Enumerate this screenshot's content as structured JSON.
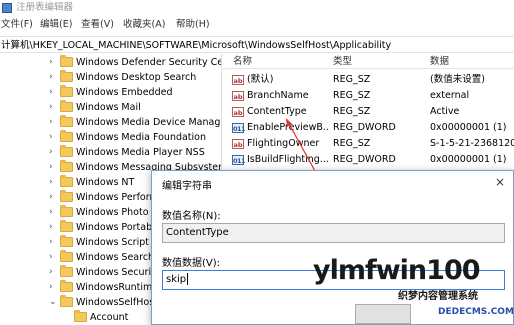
{
  "window": {
    "title": "注册表编辑器"
  },
  "menu": [
    "文件(F)",
    "编辑(E)",
    "查看(V)",
    "收藏夹(A)",
    "帮助(H)"
  ],
  "address": "计算机\\HKEY_LOCAL_MACHINE\\SOFTWARE\\Microsoft\\WindowsSelfHost\\Applicability",
  "tree": [
    "Windows Defender Security Ce",
    "Windows Desktop Search",
    "Windows Embedded",
    "Windows Mail",
    "Windows Media Device Manag",
    "Windows Media Foundation",
    "Windows Media Player NSS",
    "Windows Messaging Subsystem",
    "Windows NT",
    "Windows Perform",
    "Windows Photo V",
    "Windows Portabl",
    "Windows Script H",
    "Windows Search",
    "Windows Security",
    "WindowsRuntime",
    "WindowsSelfHost",
    "Account"
  ],
  "list": {
    "headers": {
      "name": "名称",
      "type": "类型",
      "data": "数据"
    },
    "rows": [
      {
        "icon": "string",
        "name": "(默认)",
        "type": "REG_SZ",
        "data": "(数值未设置)"
      },
      {
        "icon": "string",
        "name": "BranchName",
        "type": "REG_SZ",
        "data": "external"
      },
      {
        "icon": "string",
        "name": "ContentType",
        "type": "REG_SZ",
        "data": "Active"
      },
      {
        "icon": "binary",
        "name": "EnablePreviewB...",
        "type": "REG_DWORD",
        "data": "0x00000001 (1)"
      },
      {
        "icon": "string",
        "name": "FlightingOwner",
        "type": "REG_SZ",
        "data": "S-1-5-21-23681208"
      },
      {
        "icon": "binary",
        "name": "IsBuildFlighting...",
        "type": "REG_DWORD",
        "data": "0x00000001 (1)"
      }
    ]
  },
  "dialog": {
    "title": "编辑字符串",
    "close": "×",
    "name_label": "数值名称(N):",
    "name_value": "ContentType",
    "data_label": "数值数据(V):",
    "data_value": "skip"
  },
  "watermark": {
    "brand": "ylmfwin100",
    "subtitle": "织梦内容管理系统",
    "url": "DEDECMS.COM"
  },
  "colors": {
    "selection": "#cce8ff",
    "accent": "#3c7fd8",
    "folder": "#f3c95c",
    "arrow": "#e0332e"
  }
}
